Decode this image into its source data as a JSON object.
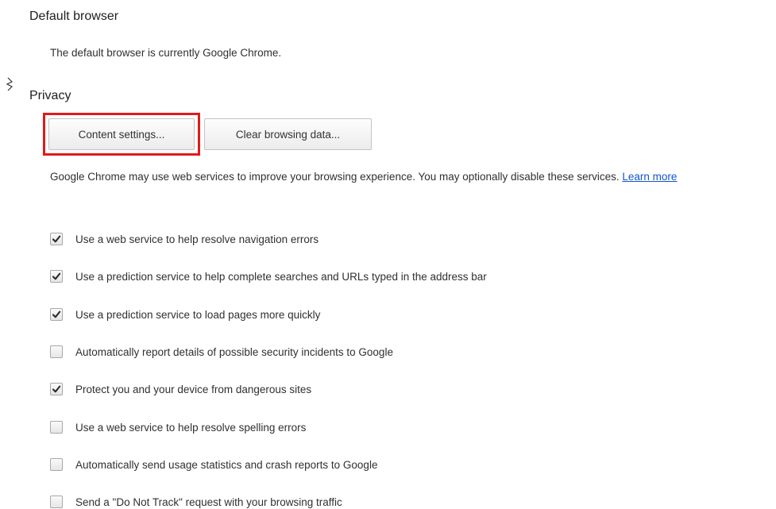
{
  "default_browser": {
    "title": "Default browser",
    "status": "The default browser is currently Google Chrome."
  },
  "privacy": {
    "title": "Privacy",
    "content_settings_label": "Content settings...",
    "clear_browsing_label": "Clear browsing data...",
    "description": "Google Chrome may use web services to improve your browsing experience. You may optionally disable these services.",
    "learn_more": "Learn more",
    "options": [
      {
        "label": "Use a web service to help resolve navigation errors",
        "checked": true
      },
      {
        "label": "Use a prediction service to help complete searches and URLs typed in the address bar",
        "checked": true
      },
      {
        "label": "Use a prediction service to load pages more quickly",
        "checked": true
      },
      {
        "label": "Automatically report details of possible security incidents to Google",
        "checked": false
      },
      {
        "label": "Protect you and your device from dangerous sites",
        "checked": true
      },
      {
        "label": "Use a web service to help resolve spelling errors",
        "checked": false
      },
      {
        "label": "Automatically send usage statistics and crash reports to Google",
        "checked": false
      },
      {
        "label": "Send a \"Do Not Track\" request with your browsing traffic",
        "checked": false
      }
    ]
  },
  "colors": {
    "highlight": "#e21a1a",
    "link": "#1155cc"
  },
  "icons": {
    "checkmark": "checkmark-icon",
    "cursor": "cursor-icon"
  }
}
